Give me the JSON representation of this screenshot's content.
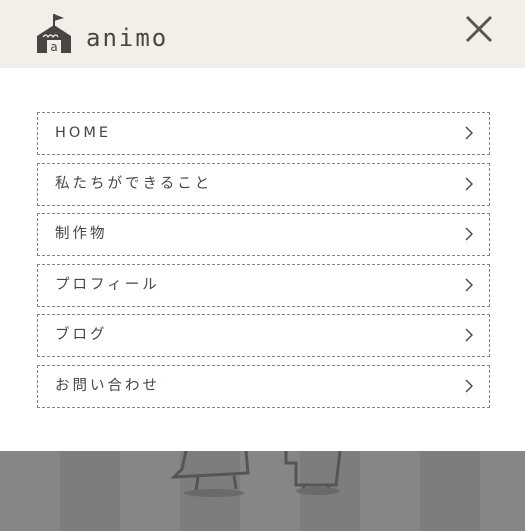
{
  "header": {
    "brand": "animo",
    "logo_letter": "a",
    "logo_icon": "school-house-icon",
    "close_icon": "close-icon"
  },
  "menu": {
    "items": [
      {
        "label": "HOME"
      },
      {
        "label": "私たちができること"
      },
      {
        "label": "制作物"
      },
      {
        "label": "プロフィール"
      },
      {
        "label": "ブログ"
      },
      {
        "label": "お問い合わせ"
      }
    ],
    "chevron_icon": "chevron-right-icon"
  },
  "colors": {
    "header_bg": "#f2efe9",
    "text": "#4a4542",
    "border": "#8a8580",
    "overlay": "#7d7d7d"
  }
}
